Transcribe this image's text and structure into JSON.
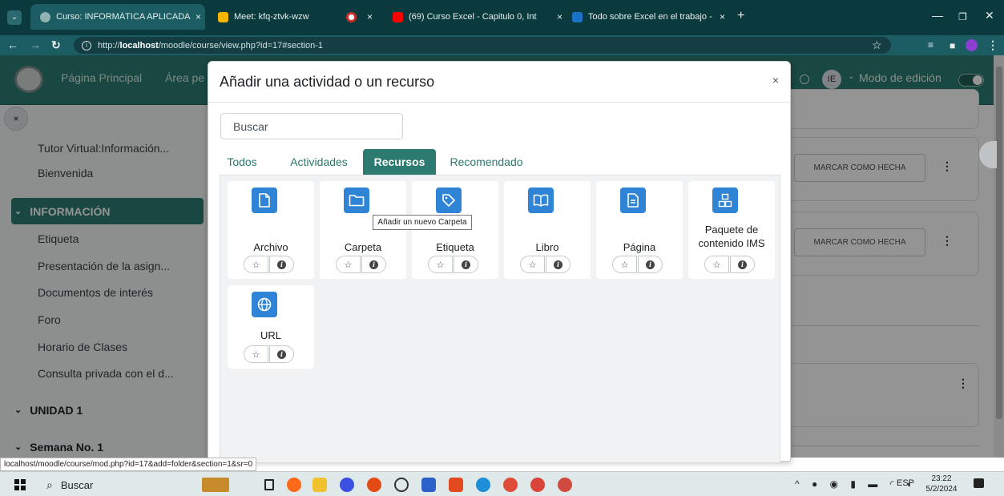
{
  "browser": {
    "tabs": [
      {
        "title": "Curso: INFORMÁTICA APLICADA",
        "close": "×",
        "color": "#8fb3b0"
      },
      {
        "title": "Meet: kfq-ztvk-wzw",
        "close": "",
        "color": "#f7b500"
      },
      {
        "title": "",
        "close": "×",
        "color": "#c9302c"
      },
      {
        "title": "(69) Curso Excel - Capitulo 0, Int",
        "close": "×",
        "color": "#ff0000"
      },
      {
        "title": "Todo sobre Excel en el trabajo -",
        "close": "×",
        "color": "#1b73c9"
      }
    ],
    "new_tab": "+",
    "url_prefix": "http://",
    "url_host": "localhost",
    "url_path": "/moodle/course/view.php?id=17#section-1"
  },
  "navbar": {
    "links": [
      "Página Principal",
      "Área pe"
    ],
    "user_initials": "IE",
    "edit_mode_label": "Modo de edición"
  },
  "drawer": {
    "close_glyph": "×",
    "items_top": [
      "Tutor Virtual:Información...",
      "Bienvenida"
    ],
    "section_info": "INFORMACIÓN",
    "items_info": [
      "Etiqueta",
      "Presentación de la asign...",
      "Documentos de interés",
      "Foro",
      "Horario de Clases",
      "Consulta privada con el d..."
    ],
    "section_unit": "UNIDAD 1",
    "section_week": "Semana No. 1"
  },
  "course": {
    "mark_done_label": "MARCAR COMO HECHA"
  },
  "modal": {
    "title": "Añadir una actividad o un recurso",
    "close": "×",
    "search_placeholder": "Buscar",
    "tabs": [
      "Todos",
      "Actividades",
      "Recursos",
      "Recomendado"
    ],
    "active_tab": "Recursos",
    "modules": [
      {
        "name": "Archivo",
        "icon": "file-icon"
      },
      {
        "name": "Carpeta",
        "icon": "folder-icon"
      },
      {
        "name": "Etiqueta",
        "icon": "tag-icon"
      },
      {
        "name": "Libro",
        "icon": "book-icon"
      },
      {
        "name": "Página",
        "icon": "page-icon"
      },
      {
        "name": "Paquete de contenido IMS",
        "icon": "package-icon"
      },
      {
        "name": "URL",
        "icon": "globe-icon"
      }
    ],
    "star_glyph": "☆",
    "info_glyph": "i",
    "tooltip": "Añadir un nuevo Carpeta",
    "accent": "#2c7a70",
    "icon_color": "#2f84d6"
  },
  "status_url": "localhost/moodle/course/mod.php?id=17&add=folder&section=1&sr=0",
  "taskbar": {
    "search_label": "Buscar",
    "lang": "ESP",
    "time": "23:22",
    "date": "5/2/2024"
  }
}
